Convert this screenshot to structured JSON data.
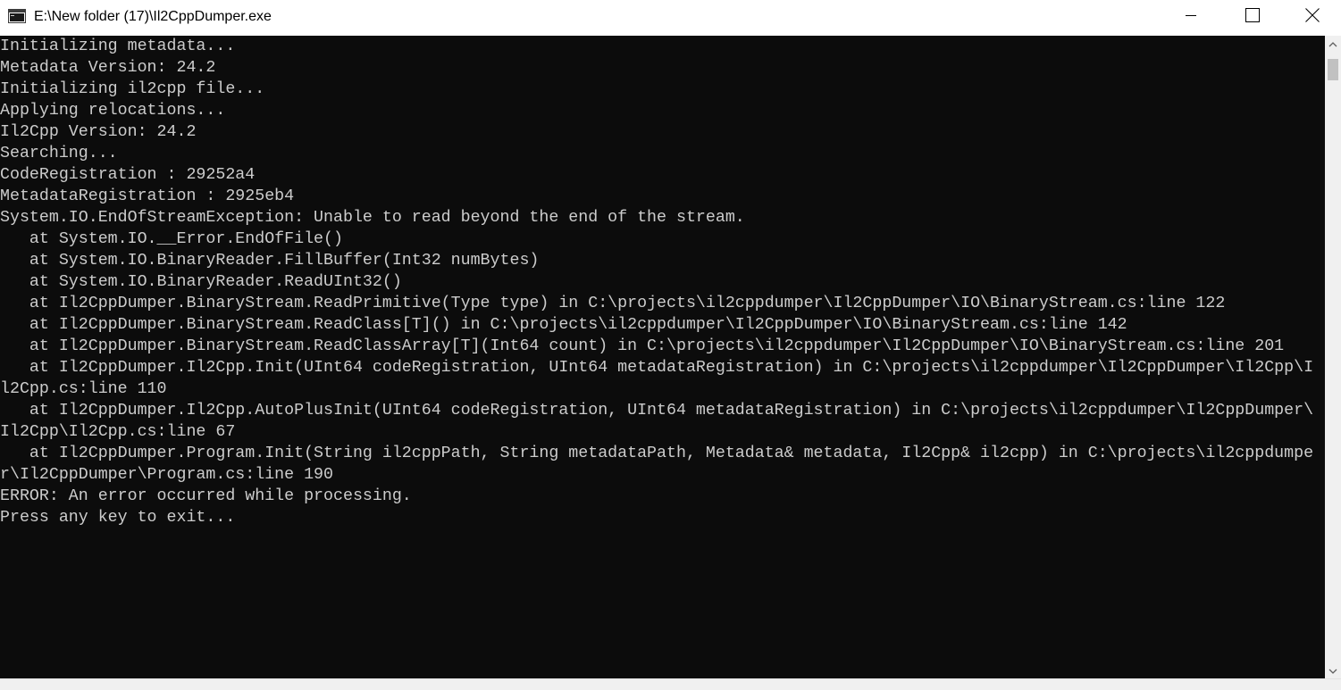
{
  "window": {
    "title": "E:\\New folder (17)\\Il2CppDumper.exe",
    "icons": {
      "app": "console-app-icon",
      "minimize": "minimize-icon",
      "maximize": "maximize-icon",
      "close": "close-icon"
    }
  },
  "console": {
    "background": "#0c0c0c",
    "foreground": "#cccccc",
    "lines": [
      "Initializing metadata...",
      "Metadata Version: 24.2",
      "Initializing il2cpp file...",
      "Applying relocations...",
      "Il2Cpp Version: 24.2",
      "Searching...",
      "CodeRegistration : 29252a4",
      "MetadataRegistration : 2925eb4",
      "System.IO.EndOfStreamException: Unable to read beyond the end of the stream.",
      "   at System.IO.__Error.EndOfFile()",
      "   at System.IO.BinaryReader.FillBuffer(Int32 numBytes)",
      "   at System.IO.BinaryReader.ReadUInt32()",
      "   at Il2CppDumper.BinaryStream.ReadPrimitive(Type type) in C:\\projects\\il2cppdumper\\Il2CppDumper\\IO\\BinaryStream.cs:line 122",
      "   at Il2CppDumper.BinaryStream.ReadClass[T]() in C:\\projects\\il2cppdumper\\Il2CppDumper\\IO\\BinaryStream.cs:line 142",
      "   at Il2CppDumper.BinaryStream.ReadClassArray[T](Int64 count) in C:\\projects\\il2cppdumper\\Il2CppDumper\\IO\\BinaryStream.cs:line 201",
      "   at Il2CppDumper.Il2Cpp.Init(UInt64 codeRegistration, UInt64 metadataRegistration) in C:\\projects\\il2cppdumper\\Il2CppDumper\\Il2Cpp\\I",
      "l2Cpp.cs:line 110",
      "   at Il2CppDumper.Il2Cpp.AutoPlusInit(UInt64 codeRegistration, UInt64 metadataRegistration) in C:\\projects\\il2cppdumper\\Il2CppDumper\\",
      "Il2Cpp\\Il2Cpp.cs:line 67",
      "   at Il2CppDumper.Program.Init(String il2cppPath, String metadataPath, Metadata& metadata, Il2Cpp& il2cpp) in C:\\projects\\il2cppdumpe",
      "r\\Il2CppDumper\\Program.cs:line 190",
      "ERROR: An error occurred while processing.",
      "Press any key to exit..."
    ]
  },
  "scrollbar": {
    "up_icon": "scroll-up-arrow-icon",
    "down_icon": "scroll-down-arrow-icon"
  }
}
